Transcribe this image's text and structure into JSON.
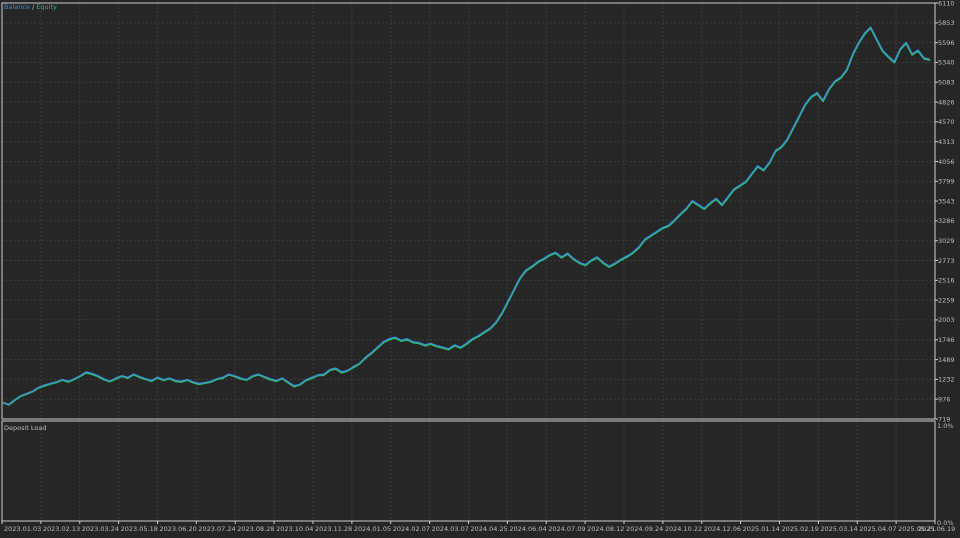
{
  "colors": {
    "background": "#262626",
    "frame": "#cfcfcf",
    "grid": "#3c3c3c",
    "balance": "#3a8ee0",
    "equity": "#2fc15c",
    "axis_text": "#bdbdbd"
  },
  "legend": {
    "balance_label": "Balance",
    "separator": "/",
    "equity_label": "Equity"
  },
  "lower_panel": {
    "title": "Deposit Load",
    "y_top_label": "1.0%",
    "y_bottom_label": "0.0%"
  },
  "chart_data": {
    "type": "line",
    "y_ticks": [
      719,
      976,
      1232,
      1489,
      1746,
      2003,
      2259,
      2516,
      2773,
      3029,
      3286,
      3543,
      3799,
      4056,
      4313,
      4570,
      4826,
      5083,
      5340,
      5596,
      5853,
      6110
    ],
    "ylim": [
      719,
      6110
    ],
    "x_ticks": [
      "2023.01.03",
      "2023.02.13",
      "2023.03.24",
      "2023.05.18",
      "2023.06.20",
      "2023.07.24",
      "2023.08.28",
      "2023.10.04",
      "2023.11.28",
      "2024.01.05",
      "2024.02.07",
      "2024.03.07",
      "2024.04.25",
      "2024.06.04",
      "2024.07.09",
      "2024.08.12",
      "2024.09.24",
      "2024.10.22",
      "2024.12.06",
      "2025.01.14",
      "2025.02.19",
      "2025.03.14",
      "2025.04.07",
      "2025.05.21",
      "2025.06.19"
    ],
    "series": [
      {
        "name": "Balance",
        "values": [
          930,
          910,
          970,
          1020,
          1050,
          1080,
          1130,
          1160,
          1180,
          1200,
          1230,
          1210,
          1240,
          1280,
          1330,
          1310,
          1280,
          1240,
          1210,
          1250,
          1280,
          1260,
          1300,
          1270,
          1240,
          1220,
          1260,
          1230,
          1250,
          1220,
          1210,
          1230,
          1200,
          1180,
          1190,
          1210,
          1240,
          1260,
          1300,
          1280,
          1250,
          1230,
          1280,
          1300,
          1270,
          1240,
          1220,
          1250,
          1200,
          1150,
          1170,
          1230,
          1260,
          1290,
          1300,
          1360,
          1380,
          1330,
          1350,
          1400,
          1440,
          1520,
          1580,
          1650,
          1720,
          1760,
          1780,
          1740,
          1760,
          1720,
          1710,
          1680,
          1700,
          1670,
          1650,
          1630,
          1680,
          1650,
          1700,
          1760,
          1800,
          1850,
          1900,
          1980,
          2100,
          2250,
          2400,
          2550,
          2650,
          2700,
          2760,
          2800,
          2850,
          2880,
          2820,
          2870,
          2800,
          2750,
          2720,
          2780,
          2820,
          2750,
          2700,
          2740,
          2790,
          2830,
          2880,
          2950,
          3050,
          3100,
          3150,
          3200,
          3230,
          3300,
          3380,
          3450,
          3550,
          3500,
          3450,
          3520,
          3580,
          3500,
          3600,
          3700,
          3750,
          3800,
          3900,
          4000,
          3950,
          4050,
          4200,
          4250,
          4350,
          4500,
          4650,
          4800,
          4900,
          4950,
          4850,
          5000,
          5100,
          5150,
          5250,
          5450,
          5600,
          5720,
          5800,
          5650,
          5500,
          5420,
          5350,
          5520,
          5600,
          5450,
          5500,
          5400,
          5380
        ]
      },
      {
        "name": "Equity",
        "values": [
          930,
          905,
          965,
          1015,
          1045,
          1075,
          1125,
          1150,
          1175,
          1195,
          1225,
          1200,
          1235,
          1275,
          1320,
          1300,
          1270,
          1230,
          1205,
          1240,
          1275,
          1250,
          1295,
          1260,
          1235,
          1210,
          1255,
          1220,
          1245,
          1210,
          1200,
          1225,
          1190,
          1170,
          1185,
          1200,
          1235,
          1250,
          1295,
          1270,
          1240,
          1225,
          1270,
          1295,
          1260,
          1230,
          1210,
          1245,
          1190,
          1140,
          1165,
          1220,
          1250,
          1285,
          1290,
          1350,
          1370,
          1320,
          1345,
          1390,
          1435,
          1510,
          1570,
          1640,
          1710,
          1750,
          1770,
          1730,
          1750,
          1710,
          1700,
          1670,
          1690,
          1660,
          1640,
          1620,
          1670,
          1640,
          1690,
          1750,
          1790,
          1840,
          1890,
          1970,
          2090,
          2240,
          2390,
          2540,
          2640,
          2690,
          2750,
          2790,
          2840,
          2870,
          2810,
          2860,
          2790,
          2740,
          2710,
          2770,
          2810,
          2740,
          2690,
          2730,
          2780,
          2820,
          2870,
          2940,
          3040,
          3090,
          3140,
          3190,
          3220,
          3290,
          3370,
          3440,
          3540,
          3490,
          3440,
          3510,
          3570,
          3490,
          3590,
          3690,
          3740,
          3790,
          3890,
          3990,
          3940,
          4040,
          4190,
          4240,
          4340,
          4490,
          4640,
          4790,
          4890,
          4940,
          4840,
          4990,
          5090,
          5140,
          5240,
          5440,
          5590,
          5710,
          5790,
          5640,
          5490,
          5410,
          5340,
          5510,
          5590,
          5440,
          5490,
          5390,
          5370
        ]
      }
    ]
  }
}
